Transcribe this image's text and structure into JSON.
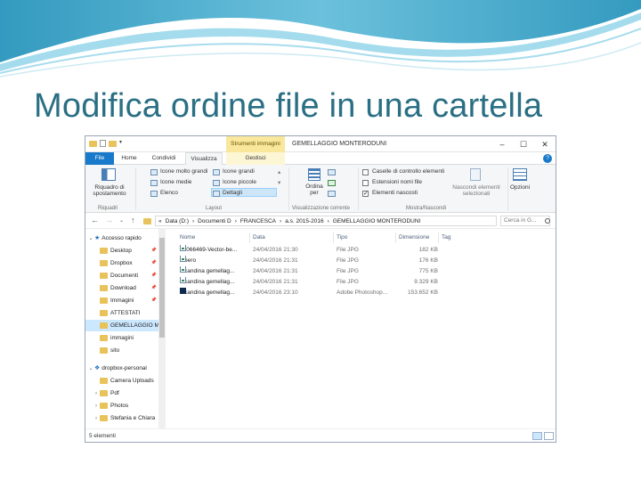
{
  "slide": {
    "title": "Modifica ordine file in una cartella"
  },
  "window": {
    "contextual_tab": "Strumenti immagini",
    "title": "GEMELLAGGIO MONTERODUNI",
    "tabs": [
      "File",
      "Home",
      "Condividi",
      "Visualizza",
      "Gestisci"
    ],
    "selected_tab": "Visualizza",
    "controls": {
      "minimize": "–",
      "maximize": "☐",
      "close": "✕"
    },
    "help": "?"
  },
  "ribbon": {
    "riquadri": {
      "button": "Riquadro di spostamento",
      "label": "Riquadri"
    },
    "layout": {
      "items": [
        "Icone molto grandi",
        "Icone grandi",
        "Icone medie",
        "Icone piccole",
        "Elenco",
        "Dettagli"
      ],
      "selected": "Dettagli",
      "label": "Layout"
    },
    "visualizzazione": {
      "button": "Ordina per",
      "label": "Visualizzazione corrente"
    },
    "mostra": {
      "checkboxes": [
        {
          "label": "Caselle di controllo elementi",
          "checked": false
        },
        {
          "label": "Estensioni nomi file",
          "checked": false
        },
        {
          "label": "Elementi nascosti",
          "checked": true
        }
      ],
      "hide_button": "Nascondi elementi selezionati",
      "label": "Mostra/Nascondi"
    },
    "opzioni": {
      "button": "Opzioni"
    }
  },
  "address": {
    "crumbs": [
      "«",
      "Data (D:)",
      "Documenti D",
      "FRANCESCA",
      "a.s. 2015-2016",
      "GEMELLAGGIO MONTERODUNI"
    ],
    "search_placeholder": "Cerca in G..."
  },
  "nav_pane": [
    {
      "label": "Accesso rapido",
      "kind": "quick",
      "indent": 0
    },
    {
      "label": "Desktop",
      "kind": "folder",
      "indent": 1,
      "pinned": true
    },
    {
      "label": "Dropbox",
      "kind": "folder",
      "indent": 1,
      "pinned": true
    },
    {
      "label": "Documenti",
      "kind": "folder",
      "indent": 1,
      "pinned": true
    },
    {
      "label": "Download",
      "kind": "folder",
      "indent": 1,
      "pinned": true
    },
    {
      "label": "Immagini",
      "kind": "folder",
      "indent": 1,
      "pinned": true
    },
    {
      "label": "ATTESTATI",
      "kind": "folder",
      "indent": 1
    },
    {
      "label": "GEMELLAGGIO M",
      "kind": "folder",
      "indent": 1,
      "selected": true
    },
    {
      "label": "immagini",
      "kind": "folder",
      "indent": 1
    },
    {
      "label": "sito",
      "kind": "folder",
      "indent": 1
    },
    {
      "label": "dropbox-personal",
      "kind": "dropbox",
      "indent": 0
    },
    {
      "label": "Camera Uploads",
      "kind": "folder",
      "indent": 1
    },
    {
      "label": "Pdf",
      "kind": "folder",
      "indent": 1
    },
    {
      "label": "Photos",
      "kind": "folder",
      "indent": 1
    },
    {
      "label": "Stefania e Chiara",
      "kind": "folder",
      "indent": 1
    }
  ],
  "columns": [
    "Nome",
    "Data",
    "Tipo",
    "Dimensione",
    "Tag"
  ],
  "files": [
    {
      "name": "23066469-Vector-be...",
      "date": "24/04/2016 21:30",
      "type": "File JPG",
      "size": "182 KB",
      "icon": "jpg"
    },
    {
      "name": "albero",
      "date": "24/04/2016 21:31",
      "type": "File JPG",
      "size": "176 KB",
      "icon": "jpg"
    },
    {
      "name": "locandina gemellag...",
      "date": "24/04/2016 21:31",
      "type": "File JPG",
      "size": "775 KB",
      "icon": "jpg"
    },
    {
      "name": "locandina gemellag...",
      "date": "24/04/2016 21:31",
      "type": "File JPG",
      "size": "9.329 KB",
      "icon": "jpg"
    },
    {
      "name": "locandina gemellag...",
      "date": "24/04/2016 23:10",
      "type": "Adobe Photoshop...",
      "size": "153.652 KB",
      "icon": "psd"
    }
  ],
  "status": {
    "count": "5 elementi"
  },
  "colors": {
    "accent": "#1979ca",
    "title": "#2a6f84",
    "folder": "#e8c25a"
  }
}
